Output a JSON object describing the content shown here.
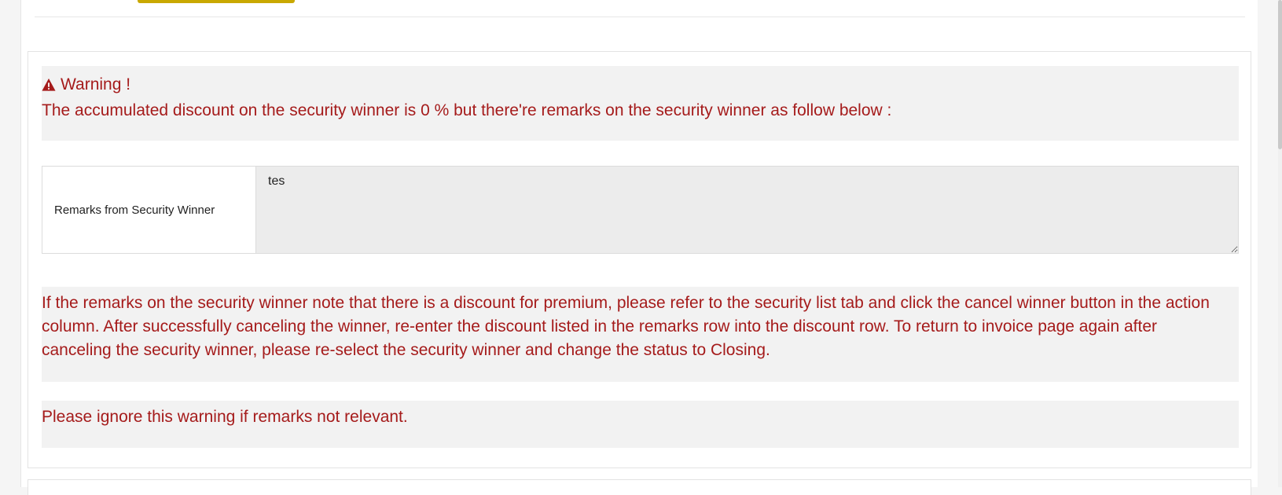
{
  "warning": {
    "title": "Warning !",
    "icon": "warning-triangle-icon",
    "message": "The accumulated discount on the security winner is 0 % but there're remarks on the security winner as follow below :"
  },
  "remarks": {
    "label": "Remarks from Security Winner",
    "value": "tes"
  },
  "info": {
    "text": "If the remarks on the security winner note that there is a discount for premium, please refer to the security list tab and click the cancel winner button in the action column. After successfully canceling the winner, re-enter the discount listed in the remarks row into the discount row. To return to invoice page again after canceling the security winner, please re-select the security winner and change the status to Closing."
  },
  "ignore": {
    "text": "Please ignore this warning if remarks not relevant."
  },
  "colors": {
    "warning_text": "#a51b1b",
    "warning_bg": "#f2f2f2",
    "accent_button": "#c9a800"
  }
}
